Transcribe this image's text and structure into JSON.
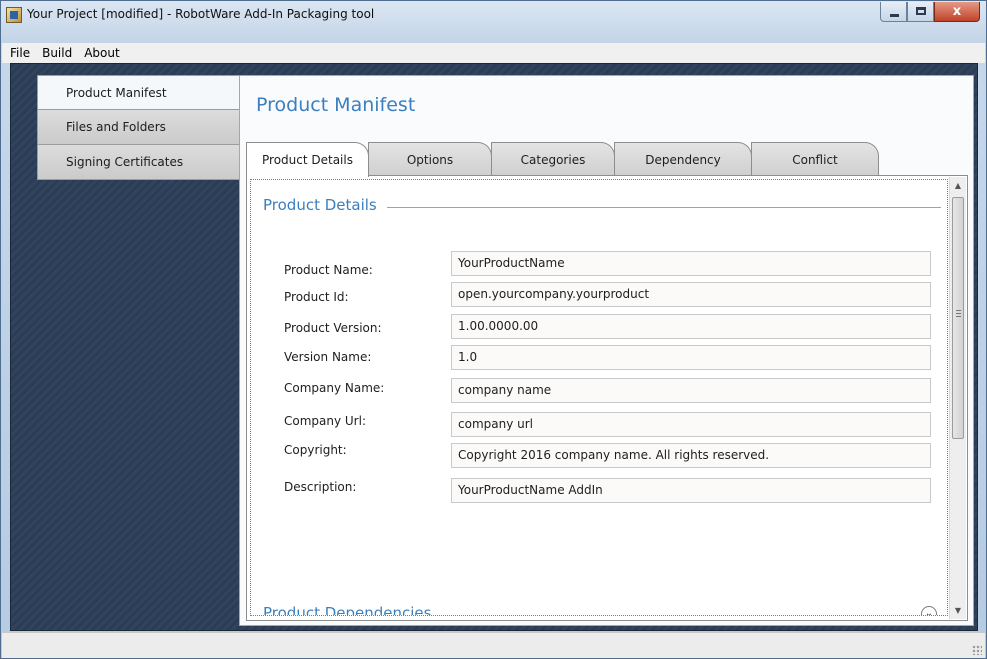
{
  "window": {
    "title": "Your Project [modified] - RobotWare Add-In Packaging tool",
    "controls": {
      "minimize_icon": "minimize-icon",
      "maximize_icon": "maximize-icon",
      "close_glyph": "x"
    }
  },
  "menu": {
    "items": [
      "File",
      "Build",
      "About"
    ]
  },
  "nav": {
    "items": [
      {
        "label": "Product Manifest",
        "active": true
      },
      {
        "label": "Files and Folders",
        "active": false
      },
      {
        "label": "Signing Certificates",
        "active": false
      }
    ]
  },
  "main": {
    "title": "Product Manifest",
    "tabs": [
      {
        "label": "Product Details",
        "active": true
      },
      {
        "label": "Options",
        "active": false
      },
      {
        "label": "Categories",
        "active": false
      },
      {
        "label": "Dependency",
        "active": false
      },
      {
        "label": "Conflict",
        "active": false
      }
    ]
  },
  "details": {
    "section_title": "Product Details",
    "fields": [
      {
        "label": "Product Name:",
        "value": "YourProductName"
      },
      {
        "label": "Product Id:",
        "value": "open.yourcompany.yourproduct"
      },
      {
        "label": "Product Version:",
        "value": "1.00.0000.00"
      },
      {
        "label": "Version Name:",
        "value": "1.0"
      },
      {
        "label": "Company Name:",
        "value": "company name"
      },
      {
        "label": "Company Url:",
        "value": "company url"
      },
      {
        "label": "Copyright:",
        "value": "Copyright 2016 company name. All rights reserved."
      },
      {
        "label": "Description:",
        "value": "YourProductName AddIn"
      }
    ],
    "next_section_title": "Product Dependencies",
    "expander_glyph": "⌄"
  },
  "colors": {
    "accent": "#3b7fbe",
    "background": "#2d3e57"
  }
}
